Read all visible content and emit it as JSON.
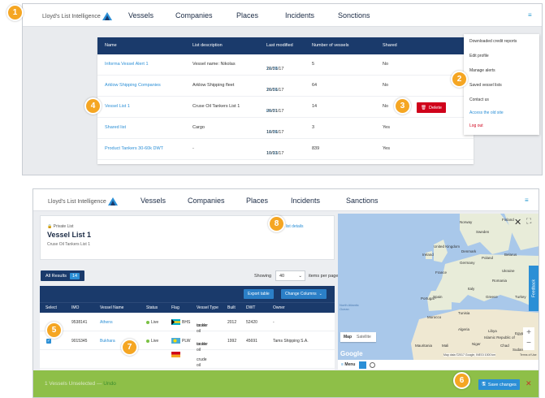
{
  "brand": "Lloyd's List Intelligence",
  "nav": [
    "Vessels",
    "Companies",
    "Places",
    "Incidents",
    "Sanctions"
  ],
  "nav_top": [
    "Vessels",
    "Companies",
    "Places",
    "Incidents",
    "Sonctions"
  ],
  "menu_icon": "hamburger-icon",
  "badges": [
    "1",
    "2",
    "3",
    "4",
    "5",
    "6",
    "7",
    "8"
  ],
  "lists_table": {
    "headers": [
      "Name",
      "List description",
      "Last modified",
      "Number of vessels",
      "Shared"
    ],
    "rows": [
      {
        "name": "Informa Vessel Alert 1",
        "desc": "Vessel name: Nikolas",
        "time": "12:38",
        "date": "26/01/17",
        "count": "5",
        "shared": "No"
      },
      {
        "name": "Arklow Shipping Companies",
        "desc": "Arklow Shipping fleet",
        "time": "10:56",
        "date": "26/01/17",
        "count": "64",
        "shared": "No"
      },
      {
        "name": "Vessel List 1",
        "desc": "Cruse Oil Tankers List 1",
        "time": "09:31",
        "date": "26/01/17",
        "count": "14",
        "shared": "No"
      },
      {
        "name": "Shared list",
        "desc": "Cargo",
        "time": "12:36",
        "date": "16/01/17",
        "count": "3",
        "shared": "Yes"
      },
      {
        "name": "Product Tankers 30-60k DWT",
        "desc": "-",
        "time": "10:13",
        "date": "10/01/17",
        "count": "839",
        "shared": "Yes"
      }
    ],
    "delete_label": "Delete"
  },
  "user_menu": [
    "Downloaded credit reports",
    "Edit profile",
    "Manage alerts",
    "Saved vessel lists",
    "Contact us",
    "Access the old site",
    "Log out"
  ],
  "detail": {
    "privacy": "Private List",
    "title": "Vessel List 1",
    "subtitle": "Cruse Oil Tankers List 1",
    "edit_label": "Edit list details",
    "all_results": "All Results",
    "count": "14",
    "showing": "Showing",
    "per_page_value": "40",
    "per_page_label": "items per page",
    "export_label": "Export table",
    "columns_label": "Change Columns",
    "headers": [
      "Select",
      "IMO",
      "Vessel Name",
      "Status",
      "Flag",
      "Vessel Type",
      "Built",
      "DWT",
      "Owner"
    ],
    "rows": [
      {
        "imo": "9538141",
        "name": "Athens",
        "status": "Live",
        "flag": "BHS",
        "type1": "crude oil",
        "type2": "tanker",
        "built": "2012",
        "dwt": "52420",
        "owner": "-",
        "checked": false
      },
      {
        "imo": "9015345",
        "name": "Bukhara",
        "status": "Live",
        "flag": "PLW",
        "type1": "crude oil",
        "type2": "tanker",
        "built": "1992",
        "dwt": "45691",
        "owner": "Tams Shipping S.A.",
        "checked": true
      },
      {
        "imo": "",
        "name": "",
        "status": "",
        "flag": "",
        "type1": "crude oil",
        "type2": "",
        "built": "",
        "dwt": "",
        "owner": "",
        "checked": false
      }
    ],
    "footer_text": "1 Vessels Unselected",
    "undo": "Undo",
    "save_label": "Save changes"
  },
  "map": {
    "feedback": "Feedback",
    "map_btn": "Map",
    "satellite_btn": "Satellite",
    "menu_label": "Menu",
    "google": "Google",
    "attribution": "Map data ©2017 Google, INEGI  1000 km",
    "terms": "Terms of Use",
    "labels": [
      {
        "t": "Norway"
      },
      {
        "t": "Finland"
      },
      {
        "t": "Sweden"
      },
      {
        "t": "United Kingdom"
      },
      {
        "t": "Ireland"
      },
      {
        "t": "Denmark"
      },
      {
        "t": "Poland"
      },
      {
        "t": "Belarus"
      },
      {
        "t": "Germany"
      },
      {
        "t": "Ukraine"
      },
      {
        "t": "France"
      },
      {
        "t": "Romania"
      },
      {
        "t": "Italy"
      },
      {
        "t": "Spain"
      },
      {
        "t": "Portugal"
      },
      {
        "t": "Greece"
      },
      {
        "t": "Turkey"
      },
      {
        "t": "Morocco"
      },
      {
        "t": "Tunisia"
      },
      {
        "t": "Algeria"
      },
      {
        "t": "Libya"
      },
      {
        "t": "Egypt"
      },
      {
        "t": "Mauritania"
      },
      {
        "t": "Mali"
      },
      {
        "t": "Niger"
      },
      {
        "t": "Chad"
      },
      {
        "t": "North Atlantic Ocean"
      },
      {
        "t": "Islamic Republic of"
      },
      {
        "t": "Sudan"
      }
    ]
  }
}
